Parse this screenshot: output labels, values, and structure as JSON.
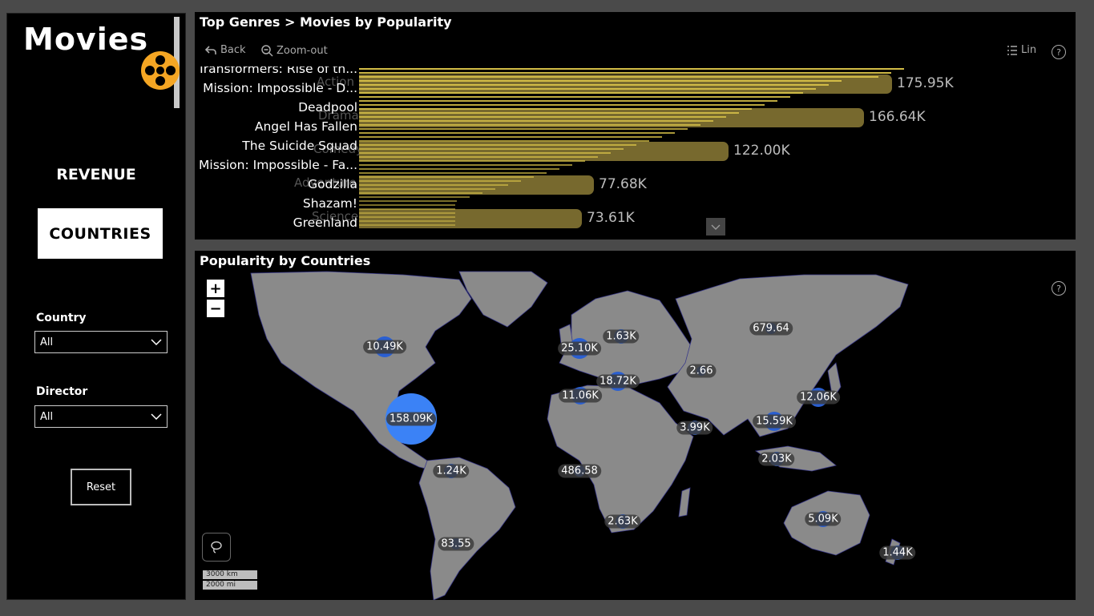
{
  "sidebar": {
    "app_title": "Movies",
    "revenue_label": "REVENUE",
    "countries_button": "COUNTRIES",
    "country_slicer": {
      "label": "Country",
      "value": "All"
    },
    "director_slicer": {
      "label": "Director",
      "value": "All"
    },
    "reset_button": "Reset"
  },
  "top_chart": {
    "title": "Top Genres > Movies by Popularity",
    "toolbar": {
      "back": "Back",
      "zoom_out": "Zoom-out",
      "lin": "Lin",
      "help": "?"
    },
    "movie_labels": [
      "Transformers: Rise of th...",
      "Mission: Impossible - D...",
      "Deadpool",
      "Angel Has Fallen",
      "The Suicide Squad",
      "Mission: Impossible - Fa...",
      "Godzilla",
      "Shazam!",
      "Greenland"
    ],
    "ghost_genres": [
      "Action",
      "Drama",
      "Comedy",
      "Adventure",
      "Science"
    ]
  },
  "chart_data": {
    "type": "bar",
    "orientation": "horizontal",
    "categories": [
      "Action",
      "Drama",
      "Comedy",
      "Adventure",
      "Science Fiction"
    ],
    "values": [
      175950,
      166640,
      122000,
      77680,
      73610
    ],
    "data_labels": [
      "175.95K",
      "166.64K",
      "122.00K",
      "77.68K",
      "73.61K"
    ],
    "xlim": [
      0,
      180000
    ],
    "colors": {
      "bar": "#77692e",
      "stripe": "#ddc64a"
    }
  },
  "map": {
    "title": "Popularity by Countries",
    "zoom_in": "+",
    "zoom_out": "−",
    "help": "?",
    "scale_km": "3000 km",
    "scale_mi": "2000 mi",
    "bubbles": [
      {
        "label": "10.49K",
        "value": 10490
      },
      {
        "label": "158.09K",
        "value": 158090
      },
      {
        "label": "1.24K",
        "value": 1240
      },
      {
        "label": "83.55",
        "value": 83.55
      },
      {
        "label": "25.10K",
        "value": 25100
      },
      {
        "label": "1.63K",
        "value": 1630
      },
      {
        "label": "18.72K",
        "value": 18720
      },
      {
        "label": "11.06K",
        "value": 11060
      },
      {
        "label": "486.58",
        "value": 486.58
      },
      {
        "label": "2.63K",
        "value": 2630
      },
      {
        "label": "679.64",
        "value": 679.64
      },
      {
        "label": "2.66",
        "value": 2.66
      },
      {
        "label": "3.99K",
        "value": 3990
      },
      {
        "label": "15.59K",
        "value": 15590
      },
      {
        "label": "12.06K",
        "value": 12060
      },
      {
        "label": "2.03K",
        "value": 2030
      },
      {
        "label": "5.09K",
        "value": 5090
      },
      {
        "label": "1.44K",
        "value": 1440
      }
    ]
  }
}
